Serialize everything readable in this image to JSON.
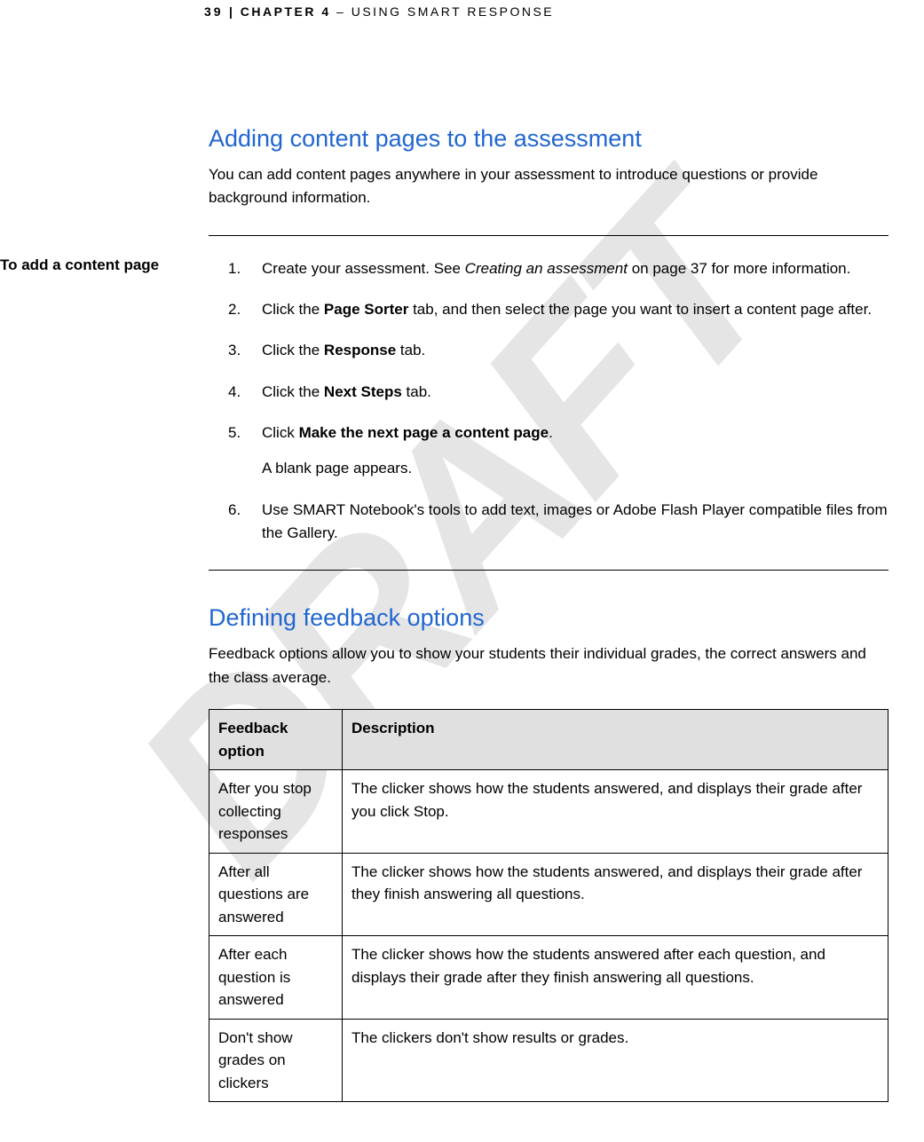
{
  "header": {
    "page_number": "39",
    "separator": "   |   ",
    "chapter_bold": "CHAPTER 4",
    "chapter_rest": "  – USING SMART RESPONSE"
  },
  "watermark": "DRAFT",
  "sidebar": {
    "add_content_label": "To add a content page"
  },
  "section1": {
    "heading": "Adding content pages to the assessment",
    "body": "You can add content pages anywhere in your assessment to introduce questions or provide background information.",
    "steps": {
      "s1a": "Create your assessment. See ",
      "s1b": "Creating an assessment",
      "s1c": " on page 37 for more information.",
      "s2a": "Click the ",
      "s2b": "Page Sorter",
      "s2c": " tab, and then select the page you want to insert a content page after.",
      "s3a": "Click the ",
      "s3b": "Response",
      "s3c": " tab.",
      "s4a": "Click the ",
      "s4b": "Next Steps",
      "s4c": " tab.",
      "s5a": "Click ",
      "s5b": "Make the next page a content page",
      "s5c": ".",
      "s5_sub": "A blank page appears.",
      "s6": "Use SMART Notebook's tools to add text, images or Adobe Flash Player compatible files from the Gallery."
    }
  },
  "section2": {
    "heading": "Defining feedback options",
    "body": "Feedback options allow you to show your students their individual grades, the correct answers and the class average.",
    "table": {
      "head_option": "Feedback option",
      "head_desc": "Description",
      "rows": {
        "r1o": "After you stop collecting responses",
        "r1d": "The clicker shows how the students answered, and displays their grade after you click Stop.",
        "r2o": "After all questions are answered",
        "r2d": "The clicker shows how the students answered, and displays their grade after they finish answering all questions.",
        "r3o": "After each question is answered",
        "r3d": "The clicker shows how the students answered after each question, and displays their grade after they finish answering all questions.",
        "r4o": "Don't show grades on clickers",
        "r4d": "The clickers don't show results or grades."
      }
    }
  }
}
